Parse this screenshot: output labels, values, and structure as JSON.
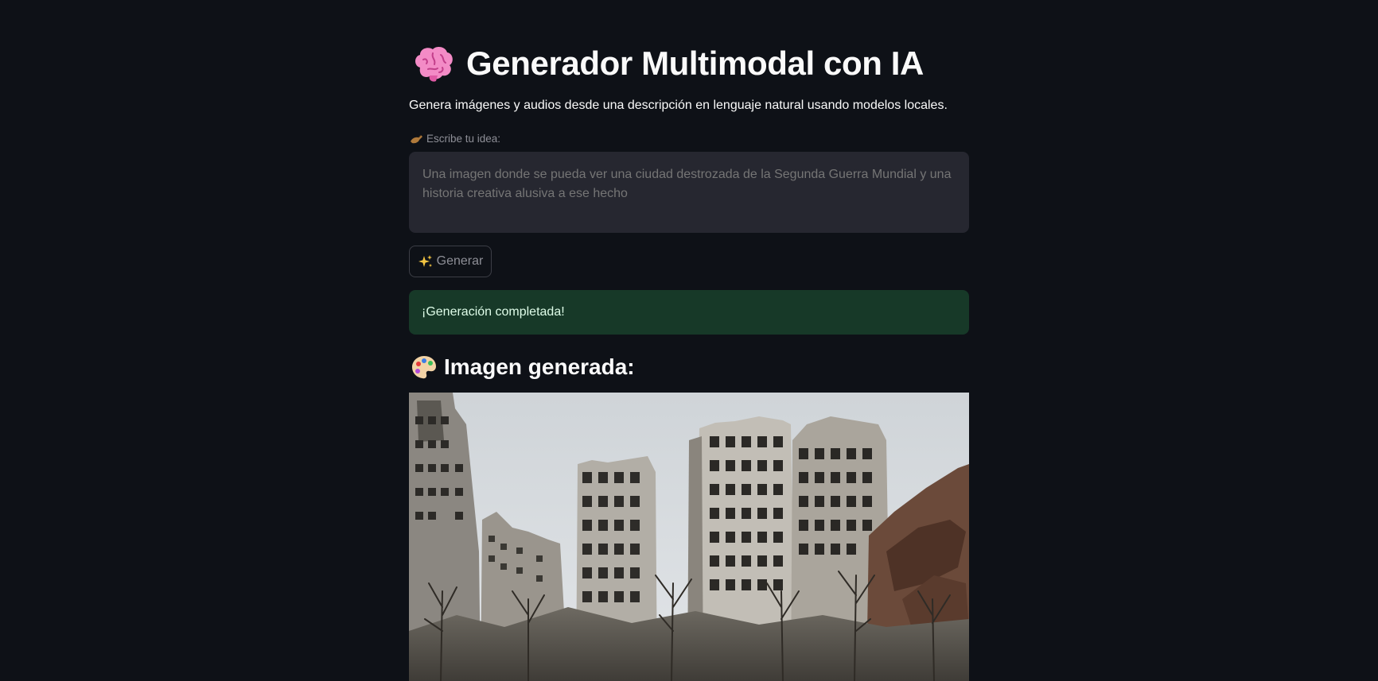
{
  "header": {
    "title": "Generador Multimodal con IA",
    "title_icon": "brain-emoji-icon",
    "subtitle": "Genera imágenes y audios desde una descripción en lenguaje natural usando modelos locales."
  },
  "prompt": {
    "label": "Escribe tu idea:",
    "label_icon": "writing-hand-icon",
    "placeholder": "Una imagen donde se pueda ver una ciudad destrozada de la Segunda Guerra Mundial y una historia creativa alusiva a ese hecho",
    "value": ""
  },
  "actions": {
    "generate_label": "Generar",
    "generate_icon": "sparkles-icon"
  },
  "status": {
    "message": "¡Generación completada!",
    "color": "#173928"
  },
  "result": {
    "section_title": "Imagen generada:",
    "section_icon": "artist-palette-icon",
    "image_subject": "ruined-city-buildings-image"
  },
  "colors": {
    "background": "#0e1117",
    "input_background": "#262730",
    "success_background": "#173928",
    "success_text": "#dffde9"
  }
}
